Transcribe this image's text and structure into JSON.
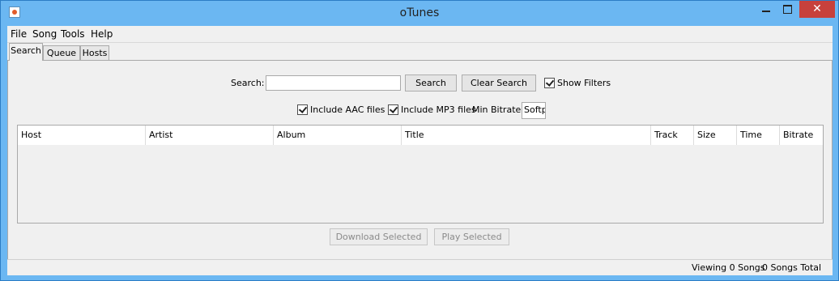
{
  "window": {
    "title": "oTunes",
    "close_glyph": "✕",
    "icon": "java-app-icon"
  },
  "menu": [
    "File",
    "Song",
    "Tools",
    "Help"
  ],
  "tabs": [
    {
      "label": "Search",
      "active": true
    },
    {
      "label": "Queue",
      "active": false
    },
    {
      "label": "Hosts",
      "active": false
    }
  ],
  "search": {
    "label": "Search:",
    "value": "",
    "search_button": "Search",
    "clear_button": "Clear Search",
    "show_filters_label": "Show Filters",
    "show_filters_checked": true
  },
  "filters": {
    "aac_label": "Include AAC files",
    "aac_checked": true,
    "mp3_label": "Include MP3 files",
    "mp3_checked": true,
    "min_bitrate_label": "Min Bitrate:",
    "min_bitrate_value": "Softp"
  },
  "table": {
    "columns": [
      "Host",
      "Artist",
      "Album",
      "Title",
      "Track",
      "Size",
      "Time",
      "Bitrate"
    ],
    "rows": []
  },
  "actions": {
    "download_selected": "Download Selected",
    "play_selected": "Play Selected"
  },
  "status": {
    "viewing": "Viewing 0 Songs",
    "total": "0 Songs Total"
  }
}
